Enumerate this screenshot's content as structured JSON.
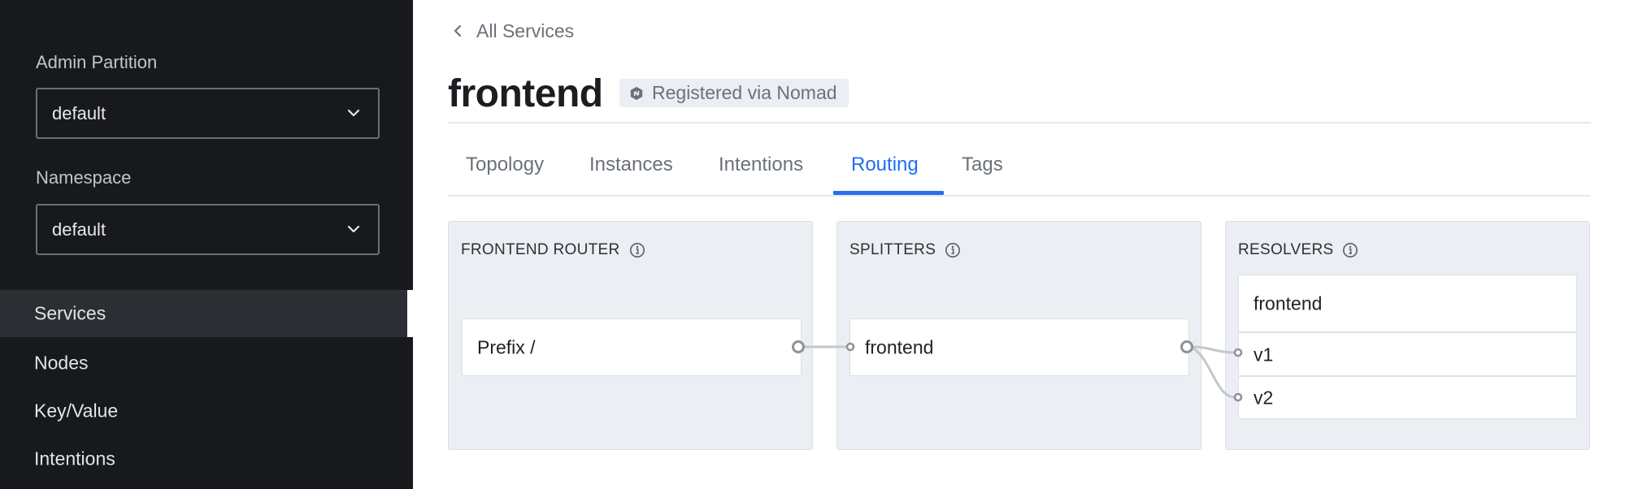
{
  "sidebar": {
    "partition": {
      "label": "Admin Partition",
      "value": "default"
    },
    "namespace": {
      "label": "Namespace",
      "value": "default"
    },
    "nav": [
      {
        "label": "Services",
        "active": true
      },
      {
        "label": "Nodes",
        "active": false
      },
      {
        "label": "Key/Value",
        "active": false
      },
      {
        "label": "Intentions",
        "active": false
      }
    ]
  },
  "header": {
    "breadcrumb": "All Services",
    "title": "frontend",
    "badge": {
      "icon": "nomad-icon",
      "label": "Registered via Nomad"
    }
  },
  "tabs": [
    {
      "label": "Topology",
      "active": false
    },
    {
      "label": "Instances",
      "active": false
    },
    {
      "label": "Intentions",
      "active": false
    },
    {
      "label": "Routing",
      "active": true
    },
    {
      "label": "Tags",
      "active": false
    }
  ],
  "routing": {
    "router": {
      "heading": "FRONTEND ROUTER",
      "routes": [
        "Prefix /"
      ]
    },
    "splitters": {
      "heading": "SPLITTERS",
      "items": [
        "frontend"
      ]
    },
    "resolvers": {
      "heading": "RESOLVERS",
      "items": [
        {
          "name": "frontend",
          "subsets": [
            "v1",
            "v2"
          ]
        }
      ]
    },
    "connections": [
      {
        "from": "Prefix /",
        "to": "frontend"
      },
      {
        "from": "frontend",
        "to": "v1"
      },
      {
        "from": "frontend",
        "to": "v2"
      }
    ]
  },
  "colors": {
    "sidebar_bg": "#17191d",
    "active_tab": "#1f6ef0",
    "card_bg": "#ebeef2"
  }
}
